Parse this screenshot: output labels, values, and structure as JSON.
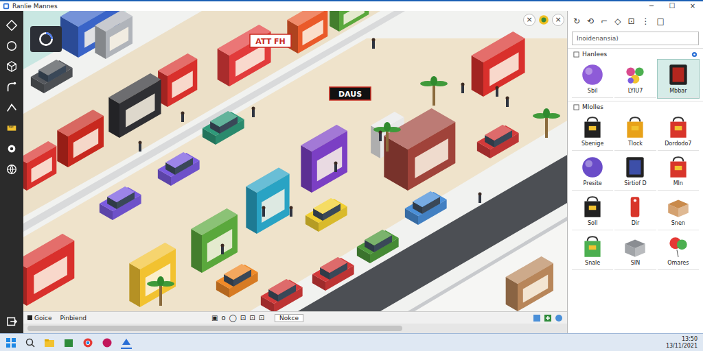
{
  "window": {
    "title": "Ranlie Mannes",
    "controls": [
      "−",
      "☐",
      "×"
    ]
  },
  "canvas": {
    "floating_buttons": [
      "×",
      "×"
    ],
    "signs": [
      {
        "text": "ATT FH"
      },
      {
        "text": "DAUS"
      }
    ]
  },
  "status_bar": {
    "left": [
      "Goice",
      "Pinbiend"
    ],
    "center": [
      "▣",
      "o",
      "◯",
      "⊡",
      "⊡",
      "⊡"
    ],
    "right_label": "Nokce"
  },
  "panel": {
    "toolbar": [
      "↻",
      "⟲",
      "⌐",
      "◇",
      "⊡",
      "⋮",
      "□"
    ],
    "search": {
      "placeholder": "Inoidenansia)"
    },
    "sections": [
      {
        "title": "Hanlees",
        "tiles": [
          {
            "label": "Sbil",
            "kind": "ball",
            "color": "#8e5bd8",
            "selected": false
          },
          {
            "label": "LYIU7",
            "kind": "grapes",
            "color": "#d94a8c",
            "selected": false
          },
          {
            "label": "Mbbar",
            "kind": "frame",
            "color": "#b3261e",
            "selected": true
          }
        ]
      },
      {
        "title": "Mlolles",
        "tiles": [
          {
            "label": "Sbenige",
            "kind": "bag",
            "color": "#222222",
            "selected": false
          },
          {
            "label": "Tlock",
            "kind": "bag",
            "color": "#e8a21a",
            "selected": false
          },
          {
            "label": "Dordodo7",
            "kind": "bag",
            "color": "#d8352a",
            "selected": false
          },
          {
            "label": "Presite",
            "kind": "ball",
            "color": "#6a4cc8",
            "selected": false
          },
          {
            "label": "Sirtiof D",
            "kind": "frame",
            "color": "#3d4fa8",
            "selected": false
          },
          {
            "label": "Mln",
            "kind": "bag",
            "color": "#d8352a",
            "selected": false
          },
          {
            "label": "Soll",
            "kind": "bag",
            "color": "#222222",
            "selected": false
          },
          {
            "label": "Dir",
            "kind": "tag",
            "color": "#d8352a",
            "selected": false
          },
          {
            "label": "Snen",
            "kind": "crate",
            "color": "#c98a4b",
            "selected": false
          },
          {
            "label": "Snale",
            "kind": "bag",
            "color": "#4caf50",
            "selected": false
          },
          {
            "label": "SIN",
            "kind": "crate",
            "color": "#8a8d92",
            "selected": false
          },
          {
            "label": "Omares",
            "kind": "balloon",
            "color": "#e53935",
            "selected": false
          }
        ]
      }
    ]
  },
  "taskbar": {
    "time": "13:50",
    "date": "13/11/2021"
  }
}
